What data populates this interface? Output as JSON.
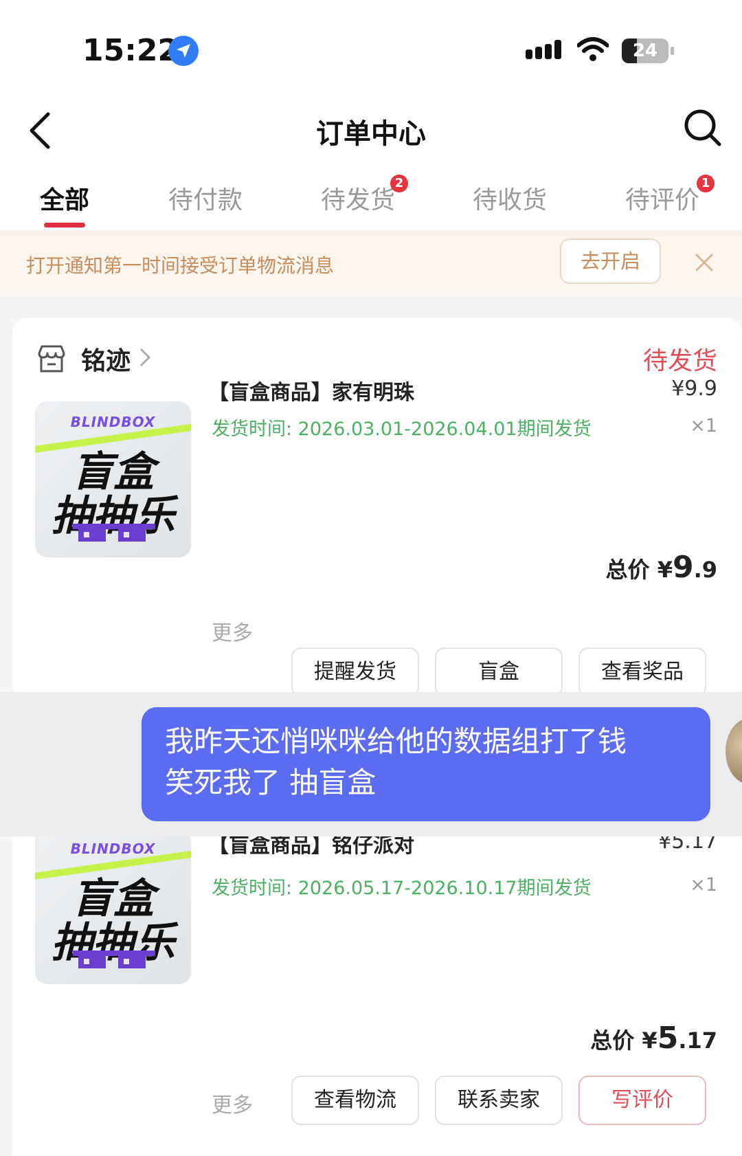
{
  "status_bar": {
    "time": "15:22",
    "battery": "24"
  },
  "header": {
    "title": "订单中心"
  },
  "tabs": [
    {
      "label": "全部",
      "badge": ""
    },
    {
      "label": "待付款",
      "badge": ""
    },
    {
      "label": "待发货",
      "badge": "2"
    },
    {
      "label": "待收货",
      "badge": ""
    },
    {
      "label": "待评价",
      "badge": "1"
    }
  ],
  "notice": {
    "text": "打开通知第一时间接受订单物流消息",
    "button": "去开启"
  },
  "orders": [
    {
      "shop": "铭迹",
      "status": "待发货",
      "thumb": {
        "brand": "BLINDBOX",
        "line1": "盲盒",
        "line2": "抽抽乐"
      },
      "name": "【盲盒商品】家有明珠",
      "ship": "发货时间: 2026.03.01-2026.04.01期间发货",
      "price": "¥9.9",
      "qty": "×1",
      "total_label": "总价",
      "total_currency": "¥",
      "total_int": "9",
      "total_dec": ".9",
      "more": "更多",
      "actions": [
        "提醒发货",
        "盲盒",
        "查看奖品"
      ]
    },
    {
      "thumb": {
        "brand": "BLINDBOX",
        "line1": "盲盒",
        "line2": "抽抽乐"
      },
      "name": "【盲盒商品】铭仔派对",
      "ship": "发货时间: 2026.05.17-2026.10.17期间发货",
      "price": "¥5.17",
      "qty": "×1",
      "total_label": "总价",
      "total_currency": "¥",
      "total_int": "5",
      "total_dec": ".17",
      "more": "更多",
      "actions": [
        "查看物流",
        "联系卖家",
        "写评价"
      ]
    }
  ],
  "chat": {
    "line1": "我昨天还悄咪咪给他的数据组打了钱",
    "line2": "笑死我了 抽盲盒"
  }
}
